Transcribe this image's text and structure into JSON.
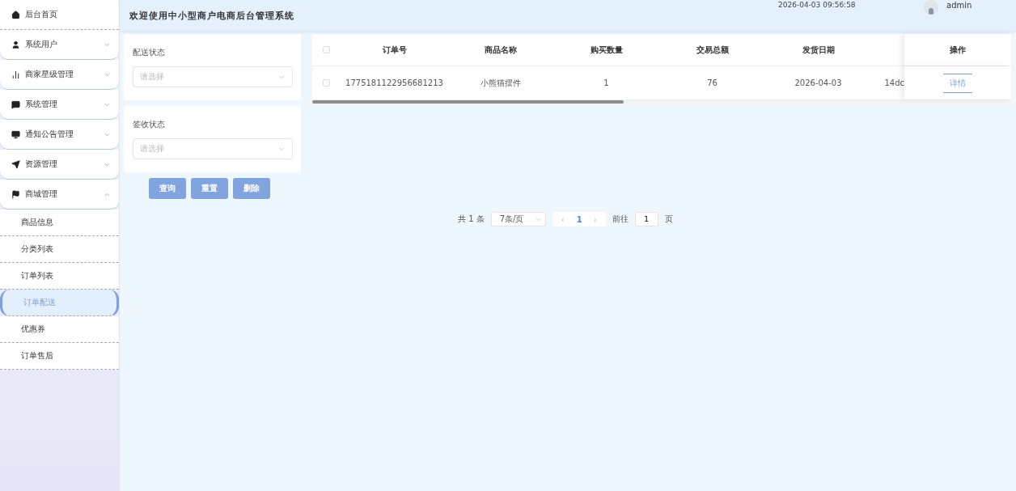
{
  "sidebar": {
    "items": [
      {
        "label": "后台首页",
        "kind": "link"
      },
      {
        "label": "系统用户",
        "kind": "group",
        "expanded": false
      },
      {
        "label": "商家星级管理",
        "kind": "group",
        "expanded": false
      },
      {
        "label": "系统管理",
        "kind": "group",
        "expanded": false
      },
      {
        "label": "通知公告管理",
        "kind": "group",
        "expanded": false
      },
      {
        "label": "资源管理",
        "kind": "group",
        "expanded": false
      },
      {
        "label": "商城管理",
        "kind": "group",
        "expanded": true,
        "children": [
          {
            "label": "商品信息",
            "selected": false
          },
          {
            "label": "分类列表",
            "selected": false
          },
          {
            "label": "订单列表",
            "selected": false
          },
          {
            "label": "订单配送",
            "selected": true
          },
          {
            "label": "优惠券",
            "selected": false
          },
          {
            "label": "订单售后",
            "selected": false
          }
        ]
      }
    ]
  },
  "header": {
    "title": "欢迎使用中小型商户电商后台管理系统",
    "datetime": "2026-04-03 09:56:58",
    "user": "admin"
  },
  "filters": [
    {
      "label": "配送状态",
      "placeholder": "请选择"
    },
    {
      "label": "签收状态",
      "placeholder": "请选择"
    }
  ],
  "actions": [
    "查询",
    "重置",
    "删除"
  ],
  "table": {
    "all_checked": false,
    "columns": [
      "订单号",
      "商品名称",
      "购买数量",
      "交易总额",
      "发货日期"
    ],
    "action_column": "操作",
    "rows": [
      {
        "checked": false,
        "cells": [
          "1775181122956681213",
          "小熊猫摆件",
          "1",
          "76",
          "2026-04-03"
        ],
        "column_7": "14dc",
        "action": "详情"
      }
    ]
  },
  "pagination": {
    "total": "共 1 条",
    "page_size": "7条/页",
    "prev": "‹",
    "current": "1",
    "next": "›",
    "goto_label": "前往",
    "goto_value": "1",
    "page_suffix": "页"
  }
}
